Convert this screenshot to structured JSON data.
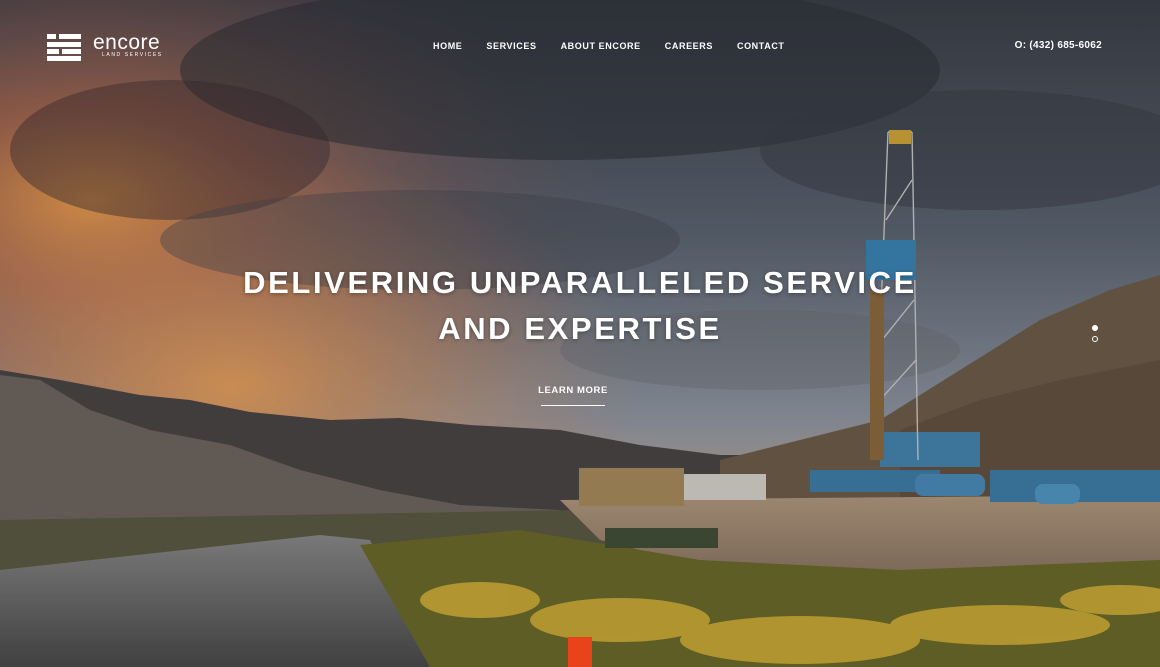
{
  "brand": {
    "name": "encore",
    "tagline": "LAND SERVICES"
  },
  "nav": {
    "items": [
      {
        "label": "HOME"
      },
      {
        "label": "SERVICES"
      },
      {
        "label": "ABOUT ENCORE"
      },
      {
        "label": "CAREERS"
      },
      {
        "label": "CONTACT"
      }
    ]
  },
  "phone": "O: (432) 685-6062",
  "hero": {
    "headline_line1": "DELIVERING UNPARALLELED SERVICE",
    "headline_line2": "AND EXPERTISE",
    "cta_label": "LEARN MORE",
    "slides": {
      "count": 2,
      "active": 1
    }
  },
  "colors": {
    "accent": "#e8431a",
    "text": "#ffffff"
  },
  "icons": {
    "logo": "stacked-bars-logo-icon"
  }
}
